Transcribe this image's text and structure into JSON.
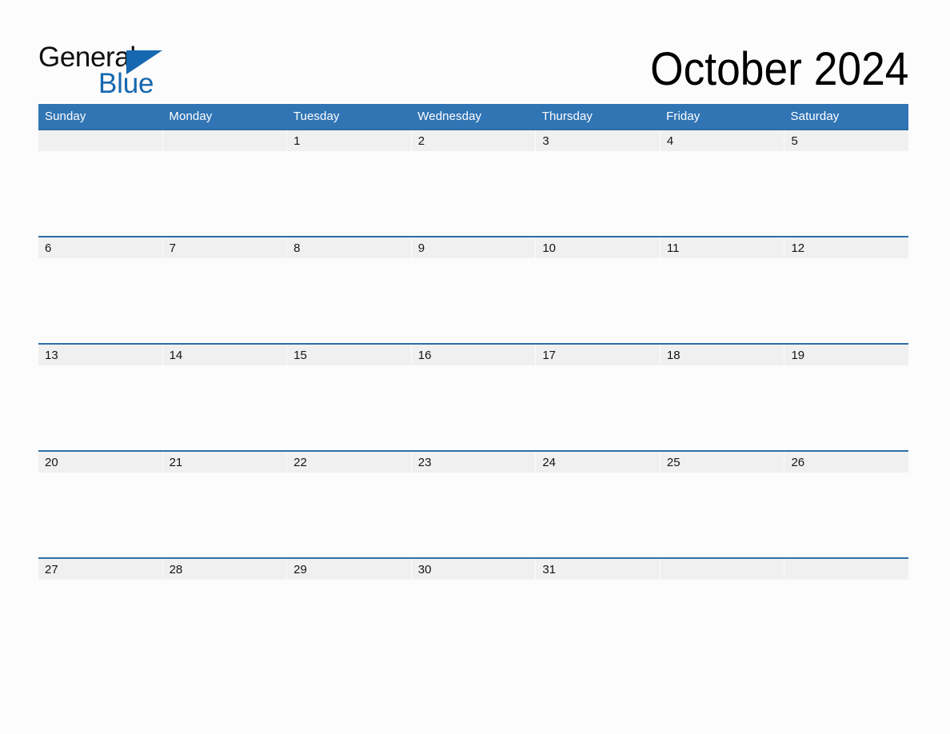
{
  "brand": {
    "name_part1": "General",
    "name_part2": "Blue",
    "triangle_icon": "blue-triangle-icon",
    "color_dark": "#101010",
    "color_blue": "#1668b0"
  },
  "header": {
    "title": "October 2024",
    "month": "October",
    "year": "2024"
  },
  "theme": {
    "header_blue": "#3175b5",
    "separator_blue": "#2e6ea8",
    "date_strip_grey": "#f0f0f0",
    "page_background": "#fcfcfc",
    "text_dark": "#141414",
    "text_white": "#ffffff"
  },
  "calendar": {
    "weekdays": [
      "Sunday",
      "Monday",
      "Tuesday",
      "Wednesday",
      "Thursday",
      "Friday",
      "Saturday"
    ],
    "weeks": [
      {
        "days": [
          "",
          "",
          "1",
          "2",
          "3",
          "4",
          "5"
        ]
      },
      {
        "days": [
          "6",
          "7",
          "8",
          "9",
          "10",
          "11",
          "12"
        ]
      },
      {
        "days": [
          "13",
          "14",
          "15",
          "16",
          "17",
          "18",
          "19"
        ]
      },
      {
        "days": [
          "20",
          "21",
          "22",
          "23",
          "24",
          "25",
          "26"
        ]
      },
      {
        "days": [
          "27",
          "28",
          "29",
          "30",
          "31",
          "",
          ""
        ]
      }
    ]
  }
}
